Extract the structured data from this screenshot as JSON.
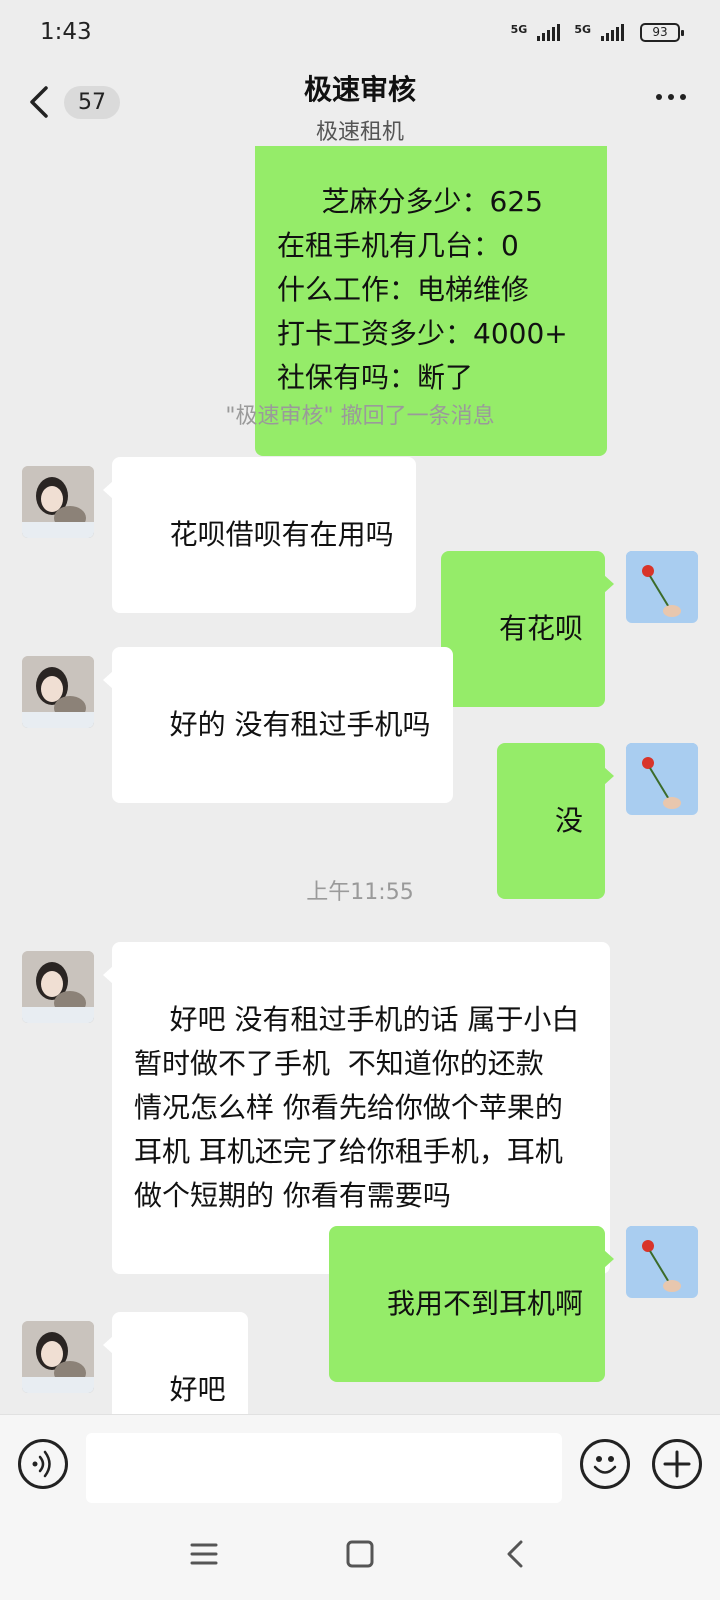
{
  "status_bar": {
    "time": "1:43",
    "network_1": "5G",
    "network_2": "5G",
    "battery": "93"
  },
  "header": {
    "back_count": "57",
    "title": "极速审核",
    "subtitle": "极速租机"
  },
  "messages": [
    {
      "side": "out",
      "text": " 芝麻分多少：625\n在租手机有几台：0\n什么工作：电梯维修\n打卡工资多少：4000+\n社保有吗：断了"
    },
    {
      "side": "system",
      "text": "\"极速审核\" 撤回了一条消息"
    },
    {
      "side": "in",
      "text": "花呗借呗有在用吗"
    },
    {
      "side": "out",
      "text": "有花呗"
    },
    {
      "side": "in",
      "text": "好的 没有租过手机吗"
    },
    {
      "side": "out",
      "text": "没"
    },
    {
      "side": "time",
      "text": "上午11:55"
    },
    {
      "side": "in",
      "text": "好吧 没有租过手机的话 属于小白\n暂时做不了手机  不知道你的还款\n情况怎么样 你看先给你做个苹果的\n耳机 耳机还完了给你租手机，耳机\n做个短期的 你看有需要吗"
    },
    {
      "side": "out",
      "text": "我用不到耳机啊"
    },
    {
      "side": "in",
      "text": "好吧"
    }
  ],
  "icons": {
    "back": "chevron-left-icon",
    "more": "more-dots-icon",
    "voice": "voice-icon",
    "emoji": "emoji-icon",
    "plus": "plus-icon",
    "nav_menu": "menu-icon",
    "nav_home": "home-square-icon",
    "nav_back": "back-triangle-icon"
  },
  "colors": {
    "outgoing_bubble": "#95ec69",
    "incoming_bubble": "#ffffff",
    "background": "#ededed"
  }
}
